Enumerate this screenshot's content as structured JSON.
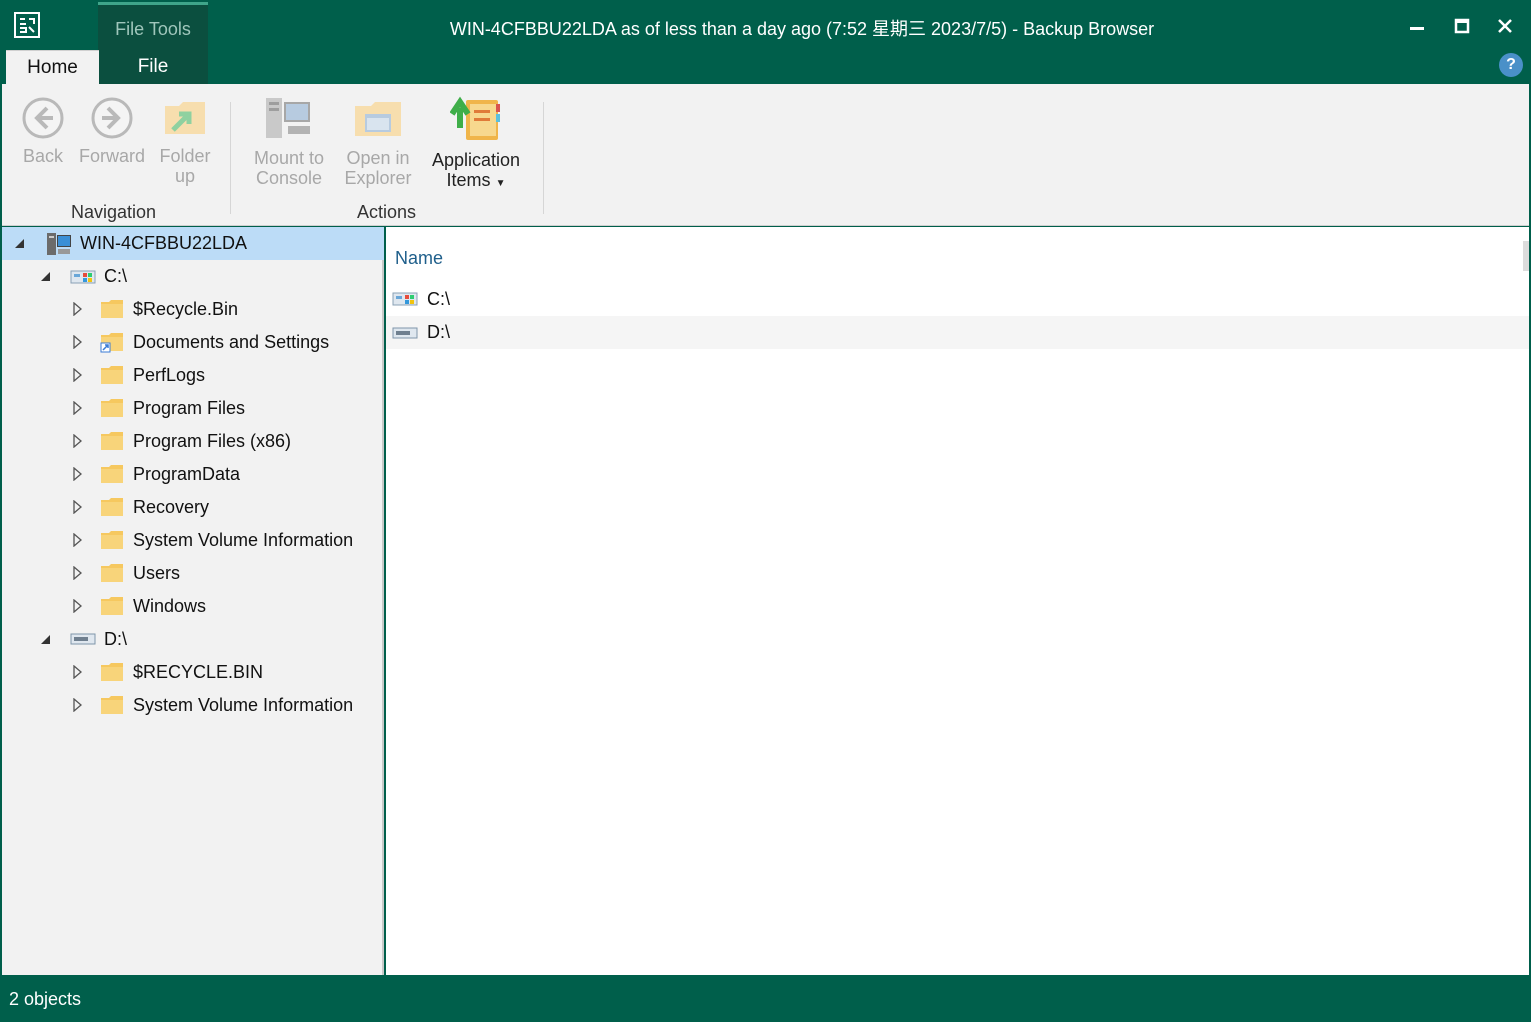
{
  "titlebar": {
    "title": "WIN-4CFBBU22LDA as of less than a day ago (7:52 星期三 2023/7/5) - Backup Browser",
    "context_tab": "File Tools",
    "app_icon": "veeam-logo-icon",
    "controls": [
      "minimize-icon",
      "maximize-icon",
      "close-icon"
    ]
  },
  "tabs": {
    "home": "Home",
    "file": "File",
    "help": "?"
  },
  "ribbon": {
    "navigation": {
      "label": "Navigation",
      "back": {
        "line1": "Back",
        "line2": ""
      },
      "forward": {
        "line1": "Forward",
        "line2": ""
      },
      "folder_up": {
        "line1": "Folder",
        "line2": "up"
      }
    },
    "actions": {
      "label": "Actions",
      "mount": {
        "line1": "Mount to",
        "line2": "Console"
      },
      "open_explorer": {
        "line1": "Open in",
        "line2": "Explorer"
      },
      "app_items": {
        "line1": "Application",
        "line2": "Items"
      }
    }
  },
  "tree": {
    "root": "WIN-4CFBBU22LDA",
    "c_drive": {
      "label": "C:\\",
      "children": [
        "$Recycle.Bin",
        "Documents and Settings",
        "PerfLogs",
        "Program Files",
        "Program Files (x86)",
        "ProgramData",
        "Recovery",
        "System Volume Information",
        "Users",
        "Windows"
      ]
    },
    "d_drive": {
      "label": "D:\\",
      "children": [
        "$RECYCLE.BIN",
        "System Volume Information"
      ]
    }
  },
  "content": {
    "column_name": "Name",
    "rows": [
      "C:\\",
      "D:\\"
    ]
  },
  "status": {
    "text": "2 objects"
  },
  "colors": {
    "accent": "#005f4b",
    "selection": "#bcdcf7",
    "folder": "#f6c85f",
    "header_text": "#1f5f8b"
  }
}
